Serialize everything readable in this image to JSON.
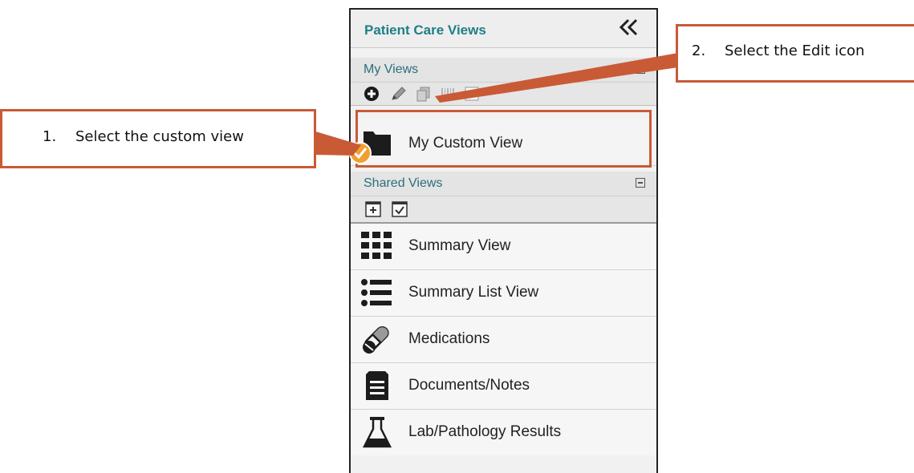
{
  "panel": {
    "title": "Patient Care Views",
    "collapse_icon": "double-chevron-left-icon",
    "accent_color": "#1e7f86"
  },
  "my_views": {
    "label": "My Views",
    "toolbar": [
      "add-icon",
      "edit-pencil-icon",
      "copy-icon",
      "barcode-icon",
      "checkbox-icon"
    ],
    "items": [
      {
        "label": "My Custom View",
        "icon": "folder-icon",
        "selected": true
      }
    ]
  },
  "shared_views": {
    "label": "Shared Views",
    "toolbar": [
      "add-box-icon",
      "checkbox-icon"
    ],
    "items": [
      {
        "label": "Summary View",
        "icon": "grid-icon"
      },
      {
        "label": "Summary List View",
        "icon": "list-icon"
      },
      {
        "label": "Medications",
        "icon": "pills-icon"
      },
      {
        "label": "Documents/Notes",
        "icon": "document-icon"
      },
      {
        "label": "Lab/Pathology Results",
        "icon": "flask-icon"
      }
    ]
  },
  "callouts": {
    "step1": {
      "number": "1.",
      "text": "Select the custom view"
    },
    "step2": {
      "number": "2.",
      "text": "Select the Edit icon"
    },
    "color": "#c95a36"
  }
}
